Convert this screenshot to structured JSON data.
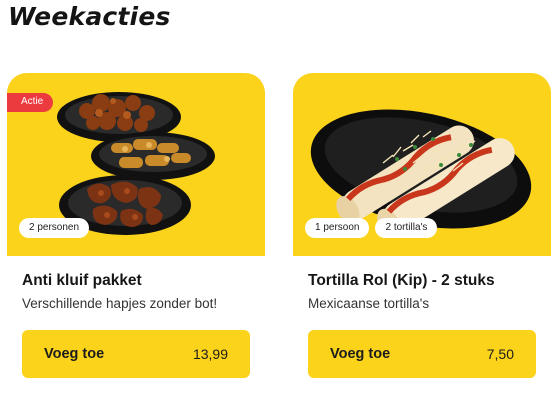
{
  "section": {
    "title": "Weekacties"
  },
  "products": [
    {
      "badge": "Actie",
      "tags": [
        "2 personen"
      ],
      "title": "Anti kluif pakket",
      "subtitle": "Verschillende hapjes zonder bot!",
      "button_label": "Voeg toe",
      "price": "13,99"
    },
    {
      "tags": [
        "1 persoon",
        "2 tortilla's"
      ],
      "title": "Tortilla Rol (Kip) - 2 stuks",
      "subtitle": "Mexicaanse tortilla's",
      "button_label": "Voeg toe",
      "price": "7,50"
    }
  ],
  "colors": {
    "accent": "#fcd31b",
    "badge": "#ec3b3f",
    "card_bg": "#ffffff"
  }
}
